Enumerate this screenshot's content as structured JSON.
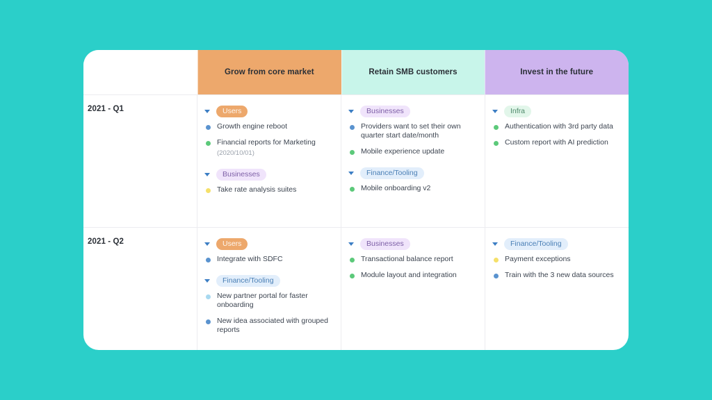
{
  "theme": {
    "background": "#2bcfc9",
    "card": "#ffffff",
    "header_grow": "#eda86c",
    "header_retain": "#c8f5ea",
    "header_invest": "#cdb4ee"
  },
  "board": {
    "corner_label": "",
    "columns": [
      {
        "label": "Grow from core market"
      },
      {
        "label": "Retain SMB customers"
      },
      {
        "label": "Invest in the future"
      }
    ],
    "rows": [
      {
        "label": "2021 - Q1",
        "cells": [
          {
            "groups": [
              {
                "tag": "Users",
                "tag_style": "users",
                "items": [
                  {
                    "text": "Growth engine reboot",
                    "dot": "blue",
                    "sub": ""
                  },
                  {
                    "text": "Financial reports for Marketing",
                    "dot": "green",
                    "sub": "(2020/10/01)"
                  }
                ]
              },
              {
                "tag": "Businesses",
                "tag_style": "business",
                "items": [
                  {
                    "text": "Take rate analysis suites",
                    "dot": "yellow",
                    "sub": ""
                  }
                ]
              }
            ]
          },
          {
            "groups": [
              {
                "tag": "Businesses",
                "tag_style": "business",
                "items": [
                  {
                    "text": "Providers want to set their own quarter start date/month",
                    "dot": "blue",
                    "sub": ""
                  },
                  {
                    "text": "Mobile experience update",
                    "dot": "green",
                    "sub": ""
                  }
                ]
              },
              {
                "tag": "Finance/Tooling",
                "tag_style": "finance",
                "items": [
                  {
                    "text": "Mobile onboarding v2",
                    "dot": "green",
                    "sub": ""
                  }
                ]
              }
            ]
          },
          {
            "groups": [
              {
                "tag": "Infra",
                "tag_style": "infra",
                "items": [
                  {
                    "text": "Authentication with 3rd party data",
                    "dot": "green",
                    "sub": ""
                  },
                  {
                    "text": "Custom report with AI prediction",
                    "dot": "green",
                    "sub": ""
                  }
                ]
              }
            ]
          }
        ]
      },
      {
        "label": "2021 - Q2",
        "cells": [
          {
            "groups": [
              {
                "tag": "Users",
                "tag_style": "users",
                "items": [
                  {
                    "text": "Integrate with SDFC",
                    "dot": "blue",
                    "sub": ""
                  }
                ]
              },
              {
                "tag": "Finance/Tooling",
                "tag_style": "finance",
                "items": [
                  {
                    "text": "New partner portal for faster onboarding",
                    "dot": "lightblue",
                    "sub": ""
                  },
                  {
                    "text": "New idea associated with grouped reports",
                    "dot": "blue",
                    "sub": ""
                  }
                ]
              }
            ]
          },
          {
            "groups": [
              {
                "tag": "Businesses",
                "tag_style": "business",
                "items": [
                  {
                    "text": "Transactional balance report",
                    "dot": "green",
                    "sub": ""
                  },
                  {
                    "text": "Module layout and integration",
                    "dot": "green",
                    "sub": ""
                  }
                ]
              }
            ]
          },
          {
            "groups": [
              {
                "tag": "Finance/Tooling",
                "tag_style": "finance",
                "items": [
                  {
                    "text": "Payment exceptions",
                    "dot": "yellow",
                    "sub": ""
                  },
                  {
                    "text": "Train with the 3 new data sources",
                    "dot": "blue",
                    "sub": ""
                  }
                ]
              }
            ]
          }
        ]
      }
    ]
  }
}
